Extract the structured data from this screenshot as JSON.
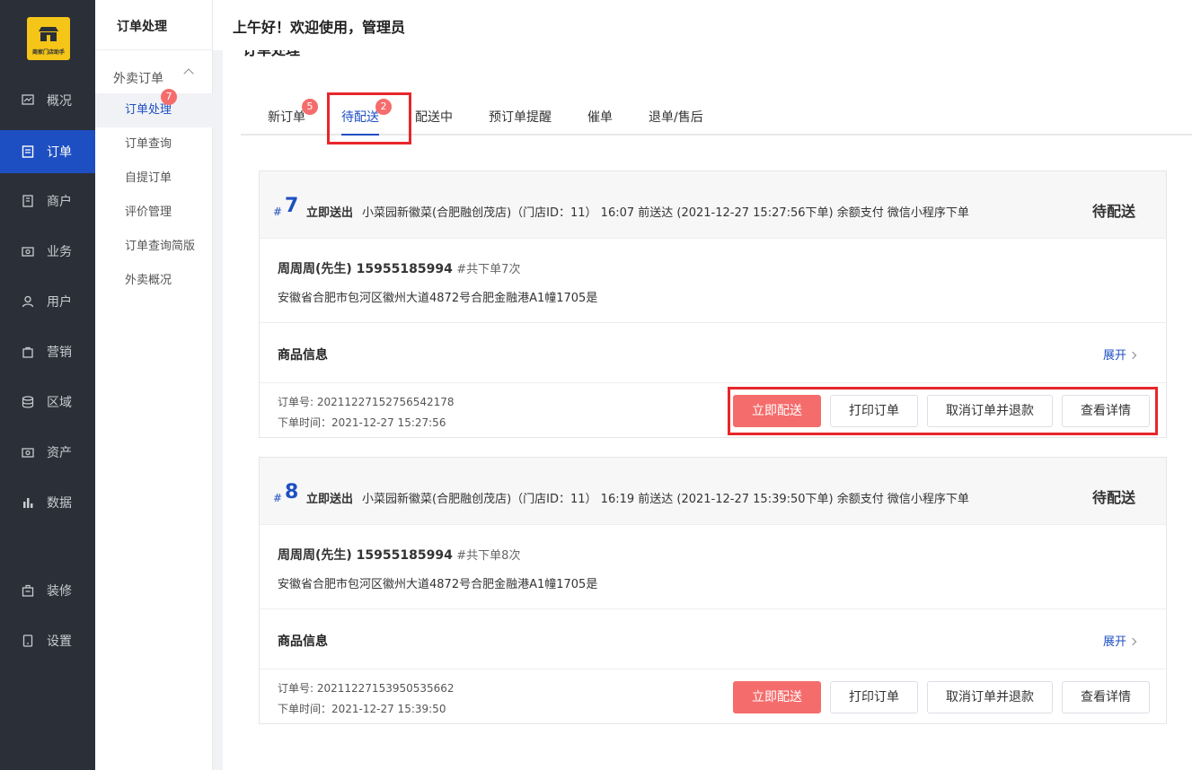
{
  "app": {
    "logo_text": "商家门店助手"
  },
  "leftnav": {
    "items": [
      {
        "label": "概况",
        "icon": "chart-icon"
      },
      {
        "label": "订单",
        "icon": "order-icon",
        "active": true
      },
      {
        "label": "商户",
        "icon": "building-icon"
      },
      {
        "label": "业务",
        "icon": "briefcase-icon"
      },
      {
        "label": "用户",
        "icon": "user-icon"
      },
      {
        "label": "营销",
        "icon": "bag-icon"
      },
      {
        "label": "区域",
        "icon": "database-icon"
      },
      {
        "label": "资产",
        "icon": "wallet-icon"
      },
      {
        "label": "数据",
        "icon": "bar-chart-icon"
      },
      {
        "label": "装修",
        "icon": "paint-icon"
      },
      {
        "label": "设置",
        "icon": "settings-icon"
      }
    ]
  },
  "subnav": {
    "title": "订单处理",
    "group": "外卖订单",
    "badge": "7",
    "items": [
      "订单处理",
      "订单查询",
      "自提订单",
      "评价管理",
      "订单查询简版",
      "外卖概况"
    ]
  },
  "topbar": {
    "greeting": "上午好！欢迎使用，管理员"
  },
  "page": {
    "cut_title": "订单处理"
  },
  "tabs": [
    {
      "label": "新订单",
      "badge": "5"
    },
    {
      "label": "待配送",
      "badge": "2",
      "active": true
    },
    {
      "label": "配送中"
    },
    {
      "label": "预订单提醒"
    },
    {
      "label": "催单"
    },
    {
      "label": "退单/售后"
    }
  ],
  "orders": [
    {
      "hash": "#",
      "num": "7",
      "ship_type": "立即送出",
      "info": "小菜园新徽菜(合肥融创茂店)（门店ID：11） 16:07 前送达  (2021-12-27 15:27:56下单)  余额支付  微信小程序下单",
      "status": "待配送",
      "customer": "周周周(先生) 15955185994",
      "count": "#共下单7次",
      "address": "安徽省合肥市包河区徽州大道4872号合肥金融港A1幢1705是",
      "goods_title": "商品信息",
      "expand": "展开",
      "order_no": "订单号: 20211227152756542178",
      "order_time": "下单时间：2021-12-27 15:27:56",
      "actions": [
        "立即配送",
        "打印订单",
        "取消订单并退款",
        "查看详情"
      ]
    },
    {
      "hash": "#",
      "num": "8",
      "ship_type": "立即送出",
      "info": "小菜园新徽菜(合肥融创茂店)（门店ID：11） 16:19 前送达  (2021-12-27 15:39:50下单)  余额支付  微信小程序下单",
      "status": "待配送",
      "customer": "周周周(先生) 15955185994",
      "count": "#共下单8次",
      "address": "安徽省合肥市包河区徽州大道4872号合肥金融港A1幢1705是",
      "goods_title": "商品信息",
      "expand": "展开",
      "order_no": "订单号: 20211227153950535662",
      "order_time": "下单时间：2021-12-27 15:39:50",
      "actions": [
        "立即配送",
        "打印订单",
        "取消订单并退款",
        "查看详情"
      ]
    }
  ],
  "colors": {
    "accent": "#1e4fc2",
    "danger": "#f56c6c",
    "sidebar": "#2b2f38",
    "highlight_box": "#e8262b"
  }
}
